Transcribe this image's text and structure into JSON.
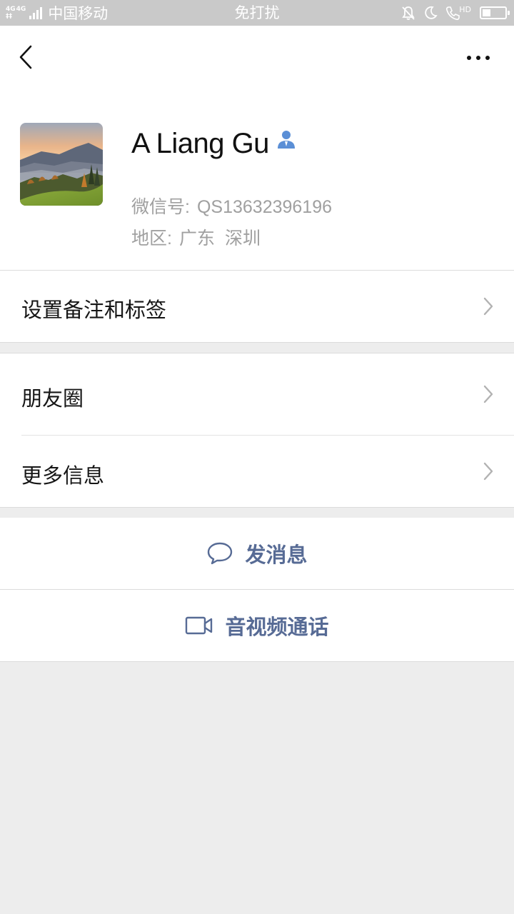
{
  "status_bar": {
    "network_types": [
      "4G",
      "4G"
    ],
    "carrier": "中国移动",
    "mode": "免打扰",
    "hd_label": "HD",
    "battery_level": 0.45
  },
  "profile": {
    "name": "A Liang Gu",
    "wechat_id_label": "微信号:",
    "wechat_id": "QS13632396196",
    "region_label": "地区:",
    "region_province": "广东",
    "region_city": "深圳"
  },
  "menu": {
    "remark_tags": "设置备注和标签",
    "moments": "朋友圈",
    "more_info": "更多信息"
  },
  "actions": {
    "send_message": "发消息",
    "video_call": "音视频通话"
  },
  "colors": {
    "link_blue": "#576b95",
    "contact_badge": "#5b8fd6",
    "background": "#ededed"
  }
}
